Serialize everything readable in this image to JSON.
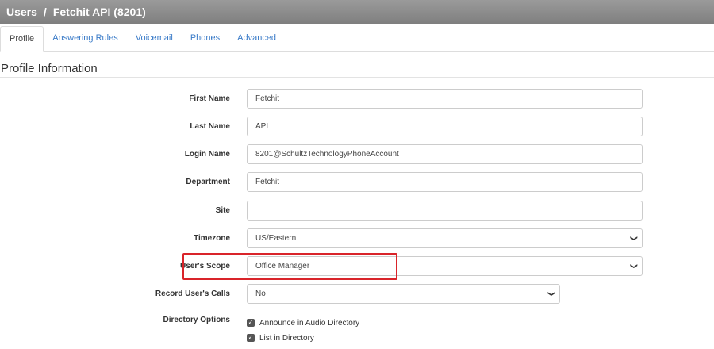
{
  "header": {
    "section": "Users",
    "separator": "/",
    "title": "Fetchit API (8201)"
  },
  "tabs": [
    {
      "label": "Profile",
      "active": true
    },
    {
      "label": "Answering Rules",
      "active": false
    },
    {
      "label": "Voicemail",
      "active": false
    },
    {
      "label": "Phones",
      "active": false
    },
    {
      "label": "Advanced",
      "active": false
    }
  ],
  "section_title": "Profile Information",
  "form": {
    "first_name": {
      "label": "First Name",
      "value": "Fetchit"
    },
    "last_name": {
      "label": "Last Name",
      "value": "API"
    },
    "login_name": {
      "label": "Login Name",
      "value": "8201@SchultzTechnologyPhoneAccount"
    },
    "department": {
      "label": "Department",
      "value": "Fetchit"
    },
    "site": {
      "label": "Site",
      "value": ""
    },
    "timezone": {
      "label": "Timezone",
      "value": "US/Eastern"
    },
    "users_scope": {
      "label": "User's Scope",
      "value": "Office Manager"
    },
    "record_calls": {
      "label": "Record User's Calls",
      "value": "No"
    },
    "directory_options": {
      "label": "Directory Options",
      "options": [
        {
          "label": "Announce in Audio Directory",
          "checked": true
        },
        {
          "label": "List in Directory",
          "checked": true
        }
      ]
    }
  },
  "colors": {
    "accent": "#3a7bc8",
    "highlight": "#d9242a",
    "header": "#8a8a8a"
  },
  "icons": {
    "select_arrow": "chevron-down-icon",
    "checkbox": "check-icon"
  }
}
